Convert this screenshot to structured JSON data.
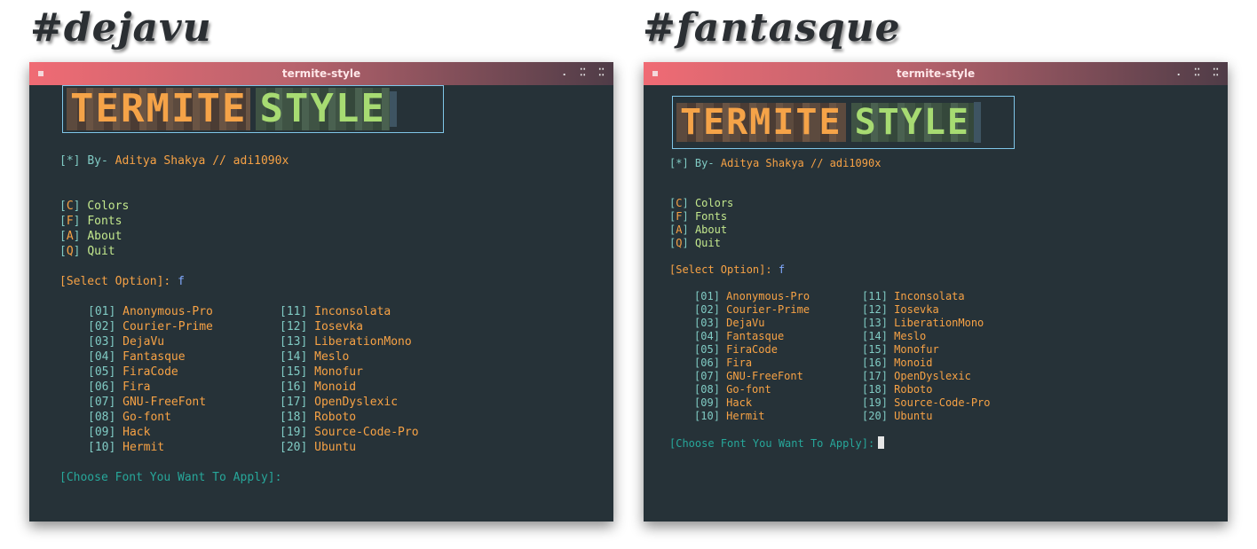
{
  "panels": [
    {
      "heading": "#dejavu",
      "window_title": "termite-style",
      "logo": {
        "word1": "TERMITE",
        "word2": "STYLE"
      },
      "byline": {
        "star": "[*]",
        "by": "By-",
        "author": "Aditya Shakya // adi1090x"
      },
      "menu": [
        {
          "key": "C",
          "label": "Colors"
        },
        {
          "key": "F",
          "label": "Fonts"
        },
        {
          "key": "A",
          "label": "About"
        },
        {
          "key": "Q",
          "label": "Quit"
        }
      ],
      "select_prompt": "[Select Option]:",
      "select_value": "f",
      "choose_prompt": "[Choose Font You Want To Apply]:"
    },
    {
      "heading": "#fantasque",
      "window_title": "termite-style",
      "logo": {
        "word1": "TERMITE",
        "word2": "STYLE"
      },
      "byline": {
        "star": "[*]",
        "by": "By-",
        "author": "Aditya Shakya // adi1090x"
      },
      "menu": [
        {
          "key": "C",
          "label": "Colors"
        },
        {
          "key": "F",
          "label": "Fonts"
        },
        {
          "key": "A",
          "label": "About"
        },
        {
          "key": "Q",
          "label": "Quit"
        }
      ],
      "select_prompt": "[Select Option]:",
      "select_value": "f",
      "choose_prompt": "[Choose Font You Want To Apply]:"
    }
  ],
  "fonts": [
    {
      "num": "01",
      "name": "Anonymous-Pro"
    },
    {
      "num": "02",
      "name": "Courier-Prime"
    },
    {
      "num": "03",
      "name": "DejaVu"
    },
    {
      "num": "04",
      "name": "Fantasque"
    },
    {
      "num": "05",
      "name": "FiraCode"
    },
    {
      "num": "06",
      "name": "Fira"
    },
    {
      "num": "07",
      "name": "GNU-FreeFont"
    },
    {
      "num": "08",
      "name": "Go-font"
    },
    {
      "num": "09",
      "name": "Hack"
    },
    {
      "num": "10",
      "name": "Hermit"
    },
    {
      "num": "11",
      "name": "Inconsolata"
    },
    {
      "num": "12",
      "name": "Iosevka"
    },
    {
      "num": "13",
      "name": "LiberationMono"
    },
    {
      "num": "14",
      "name": "Meslo"
    },
    {
      "num": "15",
      "name": "Monofur"
    },
    {
      "num": "16",
      "name": "Monoid"
    },
    {
      "num": "17",
      "name": "OpenDyslexic"
    },
    {
      "num": "18",
      "name": "Roboto"
    },
    {
      "num": "19",
      "name": "Source-Code-Pro"
    },
    {
      "num": "20",
      "name": "Ubuntu"
    }
  ],
  "window_controls": [
    ".",
    "⁚⁚",
    "⁚⁚"
  ],
  "colors": {
    "terminal_bg": "#263238",
    "titlebar_start": "#f06b74",
    "accent_orange": "#f7a245",
    "accent_green": "#c3e88d",
    "accent_teal": "#80cbc4"
  }
}
